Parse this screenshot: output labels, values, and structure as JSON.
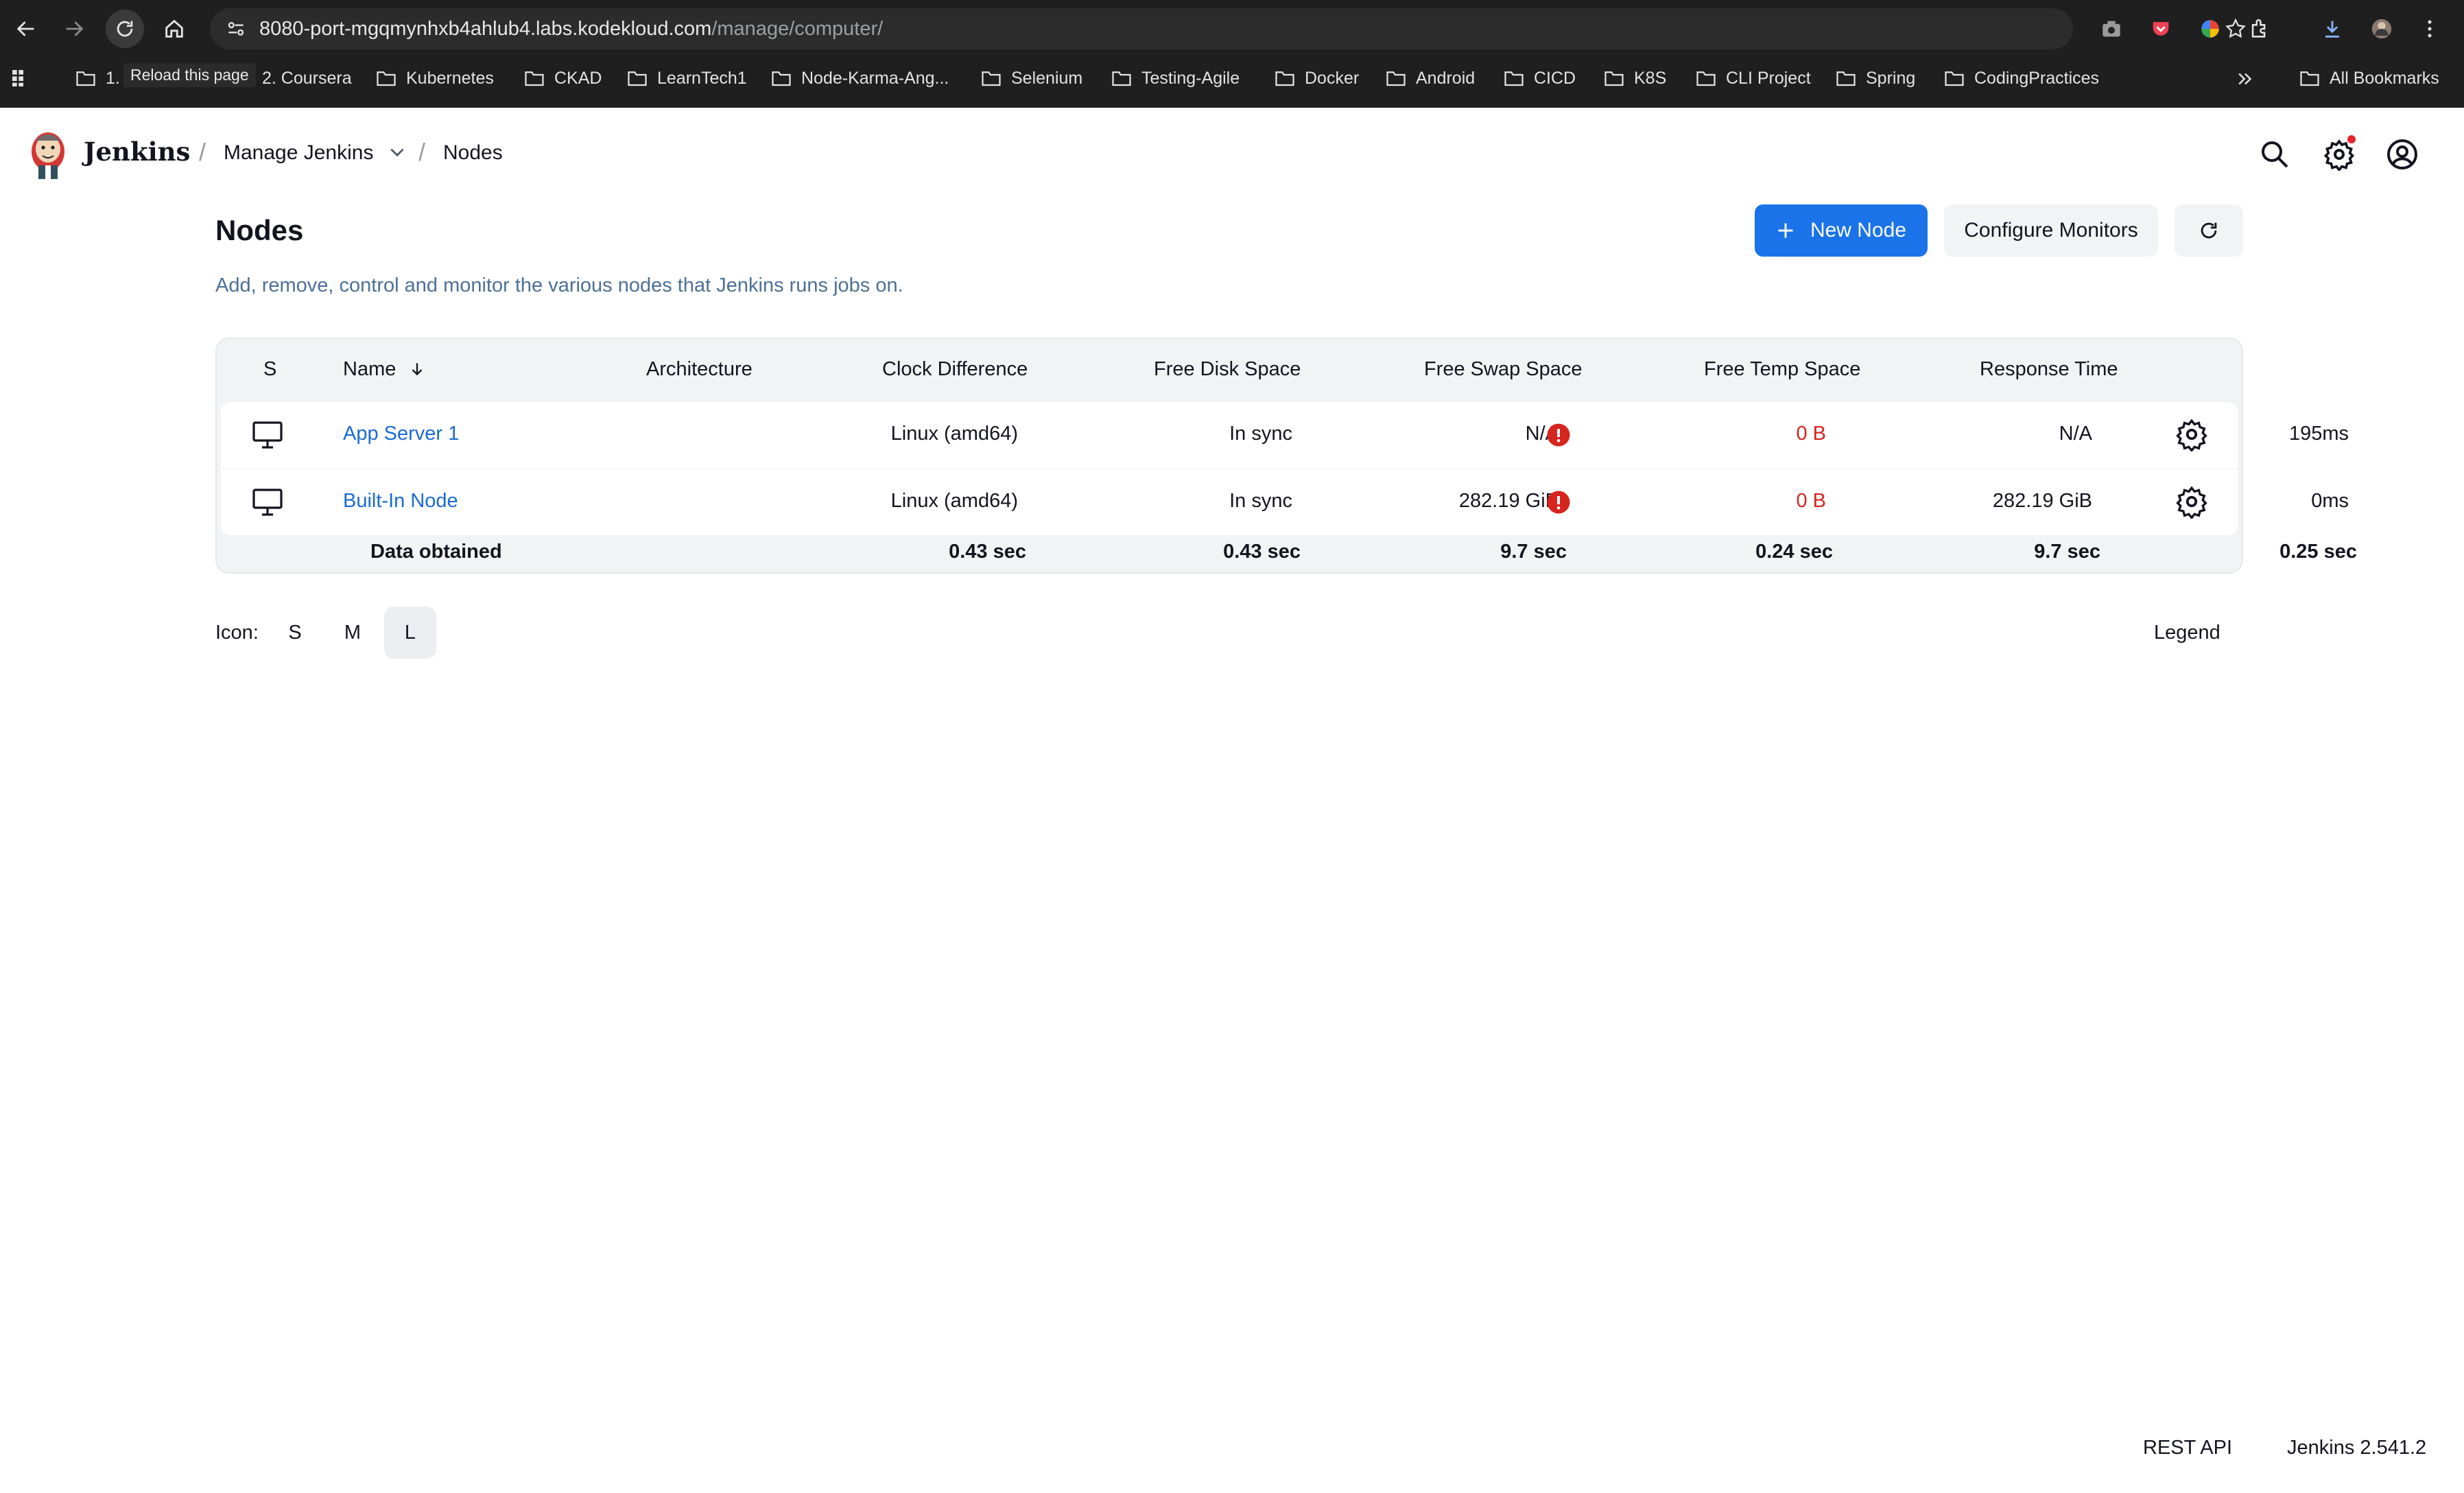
{
  "browser": {
    "url_host": "8080-port-mgqmynhxb4ahlub4.labs.kodekloud.com",
    "url_path": "/manage/computer/",
    "tooltip": "Reload this page",
    "bookmarks": [
      "1.",
      "2. Coursera",
      "Kubernetes",
      "CKAD",
      "LearnTech1",
      "Node-Karma-Ang...",
      "Selenium",
      "Testing-Agile",
      "Docker",
      "Android",
      "CICD",
      "K8S",
      "CLI Project",
      "Spring",
      "CodingPractices"
    ],
    "all_bookmarks": "All Bookmarks"
  },
  "header": {
    "brand": "Jenkins",
    "breadcrumb": [
      "Manage Jenkins",
      "Nodes"
    ]
  },
  "page": {
    "title": "Nodes",
    "description": "Add, remove, control and monitor the various nodes that Jenkins runs jobs on.",
    "new_node": "New Node",
    "configure_monitors": "Configure Monitors"
  },
  "table": {
    "headers": [
      "S",
      "Name",
      "Architecture",
      "Clock Difference",
      "Free Disk Space",
      "Free Swap Space",
      "Free Temp Space",
      "Response Time"
    ],
    "rows": [
      {
        "name": "App Server 1",
        "arch": "Linux (amd64)",
        "clock": "In sync",
        "disk": "N/A",
        "swap": "0 B",
        "temp": "N/A",
        "response": "195ms"
      },
      {
        "name": "Built-In Node",
        "arch": "Linux (amd64)",
        "clock": "In sync",
        "disk": "282.19 GiB",
        "swap": "0 B",
        "temp": "282.19 GiB",
        "response": "0ms"
      }
    ],
    "footer": {
      "label": "Data obtained",
      "arch": "0.43 sec",
      "clock": "0.43 sec",
      "disk": "9.7 sec",
      "swap": "0.24 sec",
      "temp": "9.7 sec",
      "response": "0.25 sec"
    }
  },
  "icon_size": {
    "label": "Icon:",
    "options": [
      "S",
      "M",
      "L"
    ],
    "selected": "L"
  },
  "legend": "Legend",
  "footer": {
    "rest_api": "REST API",
    "version": "Jenkins 2.541.2"
  }
}
